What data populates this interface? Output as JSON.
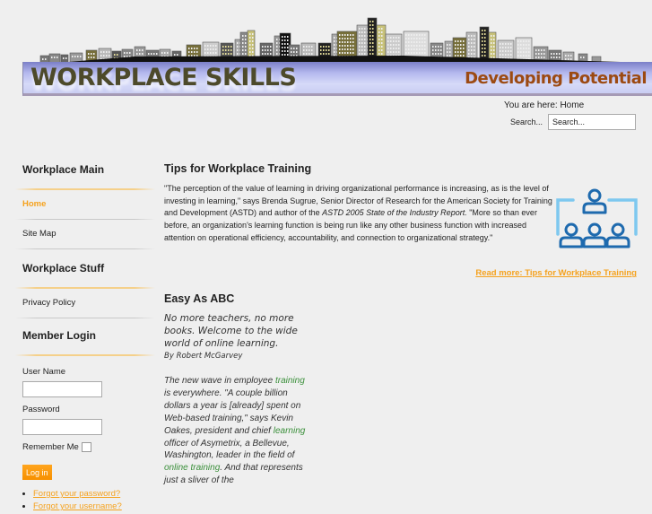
{
  "header": {
    "site_title": "WORKPLACE SKILLS",
    "tagline": "Developing Potential",
    "colors": {
      "title": "#4d4a2a",
      "tagline": "#9c4a12",
      "banner": "#b4b8ee"
    }
  },
  "breadcrumb": {
    "text": "You are here: Home"
  },
  "search": {
    "label": "Search...",
    "placeholder": "Search...",
    "value": "Search..."
  },
  "sidebar": {
    "main_menu": {
      "heading": "Workplace Main",
      "items": [
        {
          "label": "Home",
          "active": true
        },
        {
          "label": "Site Map",
          "active": false
        }
      ]
    },
    "stuff_menu": {
      "heading": "Workplace Stuff",
      "items": [
        {
          "label": "Privacy Policy"
        }
      ]
    },
    "login": {
      "heading": "Member Login",
      "username_label": "User Name",
      "username_value": "",
      "password_label": "Password",
      "password_value": "",
      "remember_label": "Remember Me",
      "remember_checked": false,
      "login_button": "Log in",
      "links": [
        "Forgot your password?",
        "Forgot your username?"
      ]
    }
  },
  "accent_color": "#f5a21e",
  "articles": [
    {
      "title": "Tips for Workplace Training",
      "body_part1": "\"The perception of the value of learning in driving organizational performance is increasing, as is the level of investing in learning,\" says Brenda Sugrue, Senior Director of Research for the American Society for Training and Development (ASTD) and author of the ",
      "body_em": "ASTD 2005 State of the Industry Report.",
      "body_part2": " \"More so than ever before, an organization's learning function is being run like any other business function with increased attention on operational efficiency, accountability, and connection to organizational strategy.\"",
      "icon": "people-hierarchy-icon",
      "read_more": "Read more: Tips for Workplace Training"
    },
    {
      "title": "Easy As ABC",
      "lead": "No more teachers, no more books. Welcome to the wide world of online learning.",
      "byline": "By Robert McGarvey",
      "body": [
        {
          "text": "The new wave in employee ",
          "link": false
        },
        {
          "text": "training",
          "link": true
        },
        {
          "text": " is everywhere. \"A couple billion dollars a year is [already] spent on Web-based training,\" says Kevin Oakes, president and chief ",
          "link": false
        },
        {
          "text": "learning",
          "link": true
        },
        {
          "text": " officer of Asymetrix, a Bellevue, Washington, leader in the field of ",
          "link": false
        },
        {
          "text": "online training",
          "link": true
        },
        {
          "text": ". And that represents just a sliver of the",
          "link": false
        }
      ],
      "link_color": "#3a8f3a"
    }
  ]
}
